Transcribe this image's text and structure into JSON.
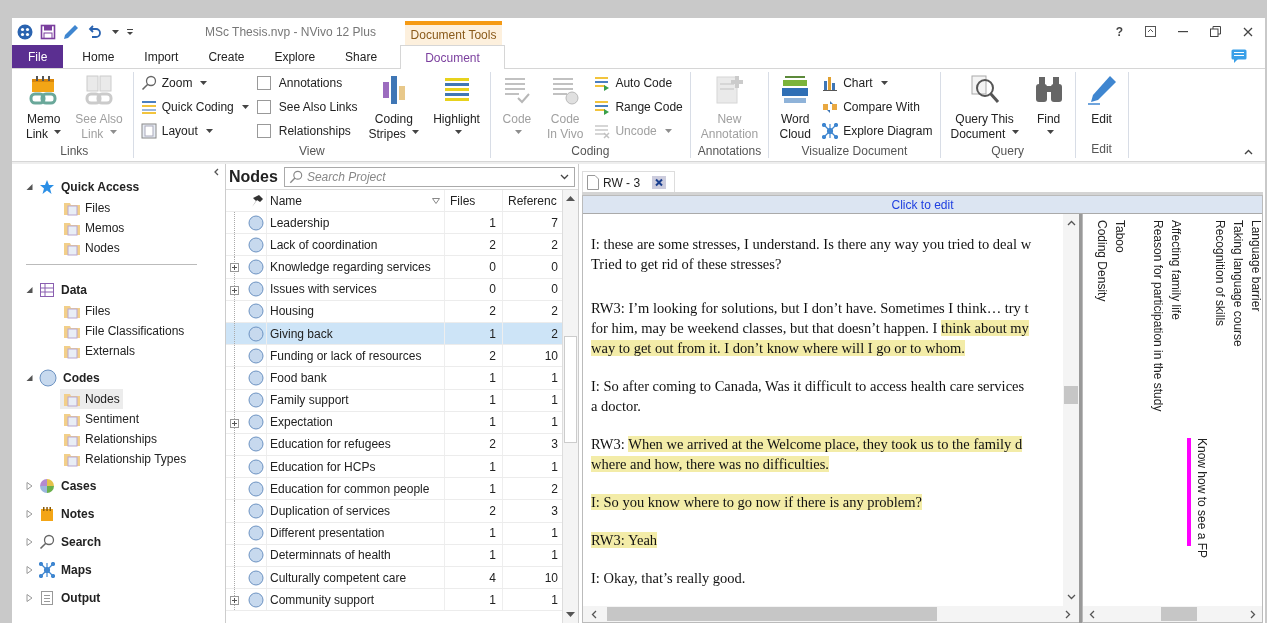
{
  "window": {
    "title": "MSc Thesis.nvp - NVivo 12 Plus",
    "help": "?"
  },
  "context_tab_group": "Document Tools",
  "tabs": [
    {
      "label": "File",
      "kind": "file",
      "selected": false
    },
    {
      "label": "Home",
      "kind": "tab",
      "selected": false
    },
    {
      "label": "Import",
      "kind": "tab",
      "selected": false
    },
    {
      "label": "Create",
      "kind": "tab",
      "selected": false
    },
    {
      "label": "Explore",
      "kind": "tab",
      "selected": false
    },
    {
      "label": "Share",
      "kind": "tab",
      "selected": false
    },
    {
      "label": "Document",
      "kind": "tab",
      "selected": true
    }
  ],
  "ribbon": {
    "groups": [
      {
        "label": "Links",
        "columns": [
          [
            {
              "kind": "large",
              "lines": [
                "Memo",
                "Link"
              ],
              "dropdown": true,
              "disabled": false
            }
          ],
          [
            {
              "kind": "large",
              "lines": [
                "See Also",
                "Link"
              ],
              "dropdown": true,
              "disabled": true
            }
          ]
        ]
      },
      {
        "label": "View",
        "columns": [
          [
            {
              "kind": "small",
              "label": "Zoom",
              "dropdown": true,
              "disabled": false
            },
            {
              "kind": "small",
              "label": "Quick Coding",
              "dropdown": true,
              "disabled": false
            },
            {
              "kind": "small",
              "label": "Layout",
              "dropdown": true,
              "disabled": false
            }
          ],
          [
            {
              "kind": "check",
              "label": "Annotations",
              "checked": false
            },
            {
              "kind": "check",
              "label": "See Also Links",
              "checked": false
            },
            {
              "kind": "check",
              "label": "Relationships",
              "checked": false
            }
          ],
          [
            {
              "kind": "large",
              "lines": [
                "Coding",
                "Stripes"
              ],
              "dropdown": true,
              "disabled": false
            }
          ],
          [
            {
              "kind": "large",
              "lines": [
                "Highlight"
              ],
              "dropdown": true,
              "disabled": false
            }
          ]
        ]
      },
      {
        "label": "Coding",
        "columns": [
          [
            {
              "kind": "large",
              "lines": [
                "Code"
              ],
              "dropdown": true,
              "disabled": true
            }
          ],
          [
            {
              "kind": "large",
              "lines": [
                "Code",
                "In Vivo"
              ],
              "dropdown": false,
              "disabled": true
            }
          ],
          [
            {
              "kind": "small",
              "label": "Auto Code",
              "dropdown": false,
              "disabled": false
            },
            {
              "kind": "small",
              "label": "Range Code",
              "dropdown": false,
              "disabled": false
            },
            {
              "kind": "small",
              "label": "Uncode",
              "dropdown": true,
              "disabled": true
            }
          ]
        ]
      },
      {
        "label": "Annotations",
        "columns": [
          [
            {
              "kind": "large",
              "lines": [
                "New",
                "Annotation"
              ],
              "dropdown": false,
              "disabled": true
            }
          ]
        ]
      },
      {
        "label": "Visualize Document",
        "columns": [
          [
            {
              "kind": "large",
              "lines": [
                "Word",
                "Cloud"
              ],
              "dropdown": false,
              "disabled": false
            }
          ],
          [
            {
              "kind": "small",
              "label": "Chart",
              "dropdown": true,
              "disabled": false
            },
            {
              "kind": "small",
              "label": "Compare With",
              "dropdown": false,
              "disabled": false
            },
            {
              "kind": "small",
              "label": "Explore Diagram",
              "dropdown": false,
              "disabled": false
            }
          ]
        ]
      },
      {
        "label": "Query",
        "columns": [
          [
            {
              "kind": "large",
              "lines": [
                "Query This",
                "Document"
              ],
              "dropdown": true,
              "disabled": false
            }
          ],
          [
            {
              "kind": "large",
              "lines": [
                "Find"
              ],
              "dropdown": true,
              "disabled": false
            }
          ]
        ]
      },
      {
        "label": "Edit",
        "columns": [
          [
            {
              "kind": "large",
              "lines": [
                "Edit"
              ],
              "dropdown": false,
              "disabled": false
            }
          ]
        ]
      }
    ]
  },
  "navigation": {
    "sections": [
      {
        "label": "Quick Access",
        "expanded": true,
        "children": [
          {
            "label": "Files",
            "selected": false
          },
          {
            "label": "Memos",
            "selected": false
          },
          {
            "label": "Nodes",
            "selected": false
          }
        ]
      },
      {
        "label": "Data",
        "expanded": true,
        "children": [
          {
            "label": "Files",
            "selected": false
          },
          {
            "label": "File Classifications",
            "selected": false
          },
          {
            "label": "Externals",
            "selected": false
          }
        ]
      },
      {
        "label": "Codes",
        "expanded": true,
        "children": [
          {
            "label": "Nodes",
            "selected": true
          },
          {
            "label": "Sentiment",
            "selected": false
          },
          {
            "label": "Relationships",
            "selected": false
          },
          {
            "label": "Relationship Types",
            "selected": false
          }
        ]
      },
      {
        "label": "Cases",
        "expanded": false
      },
      {
        "label": "Notes",
        "expanded": false
      },
      {
        "label": "Search",
        "expanded": false
      },
      {
        "label": "Maps",
        "expanded": false
      },
      {
        "label": "Output",
        "expanded": false
      }
    ]
  },
  "nodes_panel": {
    "title": "Nodes",
    "search": {
      "placeholder": "Search Project"
    },
    "columns": [
      "Name",
      "Files",
      "Referenc"
    ],
    "rows": [
      {
        "name": "Leadership",
        "files": "1",
        "references": "7",
        "expandable": false,
        "selected": false
      },
      {
        "name": "Lack of coordination",
        "files": "2",
        "references": "2",
        "expandable": false,
        "selected": false
      },
      {
        "name": "Knowledge regarding services",
        "files": "0",
        "references": "0",
        "expandable": true,
        "selected": false
      },
      {
        "name": "Issues with services",
        "files": "0",
        "references": "0",
        "expandable": true,
        "selected": false
      },
      {
        "name": "Housing",
        "files": "2",
        "references": "2",
        "expandable": false,
        "selected": false
      },
      {
        "name": "Giving back",
        "files": "1",
        "references": "2",
        "expandable": false,
        "selected": true
      },
      {
        "name": "Funding or lack of resources",
        "files": "2",
        "references": "10",
        "expandable": false,
        "selected": false
      },
      {
        "name": "Food bank",
        "files": "1",
        "references": "1",
        "expandable": false,
        "selected": false
      },
      {
        "name": "Family support",
        "files": "1",
        "references": "1",
        "expandable": false,
        "selected": false
      },
      {
        "name": "Expectation",
        "files": "1",
        "references": "1",
        "expandable": true,
        "selected": false
      },
      {
        "name": "Education for refugees",
        "files": "2",
        "references": "3",
        "expandable": false,
        "selected": false
      },
      {
        "name": "Education for HCPs",
        "files": "1",
        "references": "1",
        "expandable": false,
        "selected": false
      },
      {
        "name": "Education for common people",
        "files": "1",
        "references": "2",
        "expandable": false,
        "selected": false
      },
      {
        "name": "Duplication of services",
        "files": "2",
        "references": "3",
        "expandable": false,
        "selected": false
      },
      {
        "name": "Different presentation",
        "files": "1",
        "references": "1",
        "expandable": false,
        "selected": false
      },
      {
        "name": "Determinnats of health",
        "files": "1",
        "references": "1",
        "expandable": false,
        "selected": false
      },
      {
        "name": "Culturally competent care",
        "files": "4",
        "references": "10",
        "expandable": false,
        "selected": false
      },
      {
        "name": "Community support",
        "files": "1",
        "references": "1",
        "expandable": true,
        "selected": false
      }
    ]
  },
  "document": {
    "tab": "RW - 3",
    "edit_bar": "Click to edit",
    "paragraphs": [
      [
        [
          {
            "text": "I: these are some stresses, I understand. Is there any way you tried to deal w",
            "highlighted": false
          }
        ],
        [
          {
            "text": "Tried to get rid of these stresses?",
            "highlighted": false
          }
        ]
      ],
      [
        [
          {
            "text": "RW3: I’m looking for solutions, but I don’t have. Sometimes I think… try t",
            "highlighted": false
          }
        ],
        [
          {
            "text": "for him, may be weekend classes, but that doesn’t happen. I ",
            "highlighted": false
          },
          {
            "text": "think about my",
            "highlighted": true
          }
        ],
        [
          {
            "text": "way to get out from it. I don’t know where will I go or to whom.",
            "highlighted": true
          }
        ]
      ],
      [
        [
          {
            "text": "I: So after coming to Canada, Was it difficult to access health care services",
            "highlighted": false
          }
        ],
        [
          {
            "text": "a doctor.",
            "highlighted": false
          }
        ]
      ],
      [
        [
          {
            "text": "RW3: ",
            "highlighted": false
          },
          {
            "text": "When we arrived at the Welcome place, they took us to the family d",
            "highlighted": true
          }
        ],
        [
          {
            "text": "where and how, there was no difficulties.",
            "highlighted": true
          }
        ]
      ],
      [
        [
          {
            "text": "I: So you know where to go now if there is any problem?",
            "highlighted": true
          }
        ]
      ],
      [
        [
          {
            "text": "RW3: Yeah",
            "highlighted": true
          }
        ]
      ],
      [
        [
          {
            "text": "I: Okay, that’s really good.",
            "highlighted": false
          }
        ]
      ]
    ]
  },
  "coding_stripes": {
    "columns": [
      {
        "kind": "density",
        "label": "Coding Density"
      },
      {
        "kind": "header",
        "label": "Taboo"
      },
      {
        "kind": "header",
        "label": "Reason for participation in the study"
      },
      {
        "kind": "header",
        "label": "Affecting family life"
      },
      {
        "kind": "stripe",
        "label": "Know how to see a FP",
        "color": "#ff00ff"
      },
      {
        "kind": "header",
        "label": "Recognition of skills"
      },
      {
        "kind": "header",
        "label": "Taking language course"
      },
      {
        "kind": "header",
        "label": "Language barrier"
      }
    ]
  }
}
